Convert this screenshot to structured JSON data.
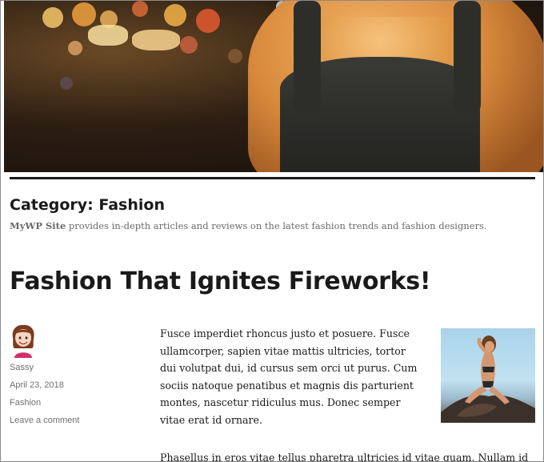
{
  "archive": {
    "title": "Category: Fashion",
    "description_site": "MyWP Site",
    "description_rest": " provides in-depth articles and reviews on the latest fashion trends and fashion designers."
  },
  "post": {
    "title": "Fashion That Ignites Fireworks!",
    "author": "Sassy",
    "date": "April 23, 2018",
    "category": "Fashion",
    "comments_link": "Leave a comment",
    "paragraph1": "Fusce imperdiet rhoncus justo et posuere. Fusce ullamcorper, sapien vitae mattis ultricies, tortor dui volutpat dui, id cursus sem orci ut purus. Cum sociis natoque penatibus et magnis dis parturient montes, nascetur ridiculus mus. Donec semper vitae erat id ornare.",
    "paragraph2": "Phasellus in eros vitae tellus pharetra ultricies id vitae quam. Nullam id"
  },
  "icons": {
    "avatar": "author-avatar-illustration",
    "hero": "header-image-mannequin",
    "post_image": "featured-image-model"
  }
}
